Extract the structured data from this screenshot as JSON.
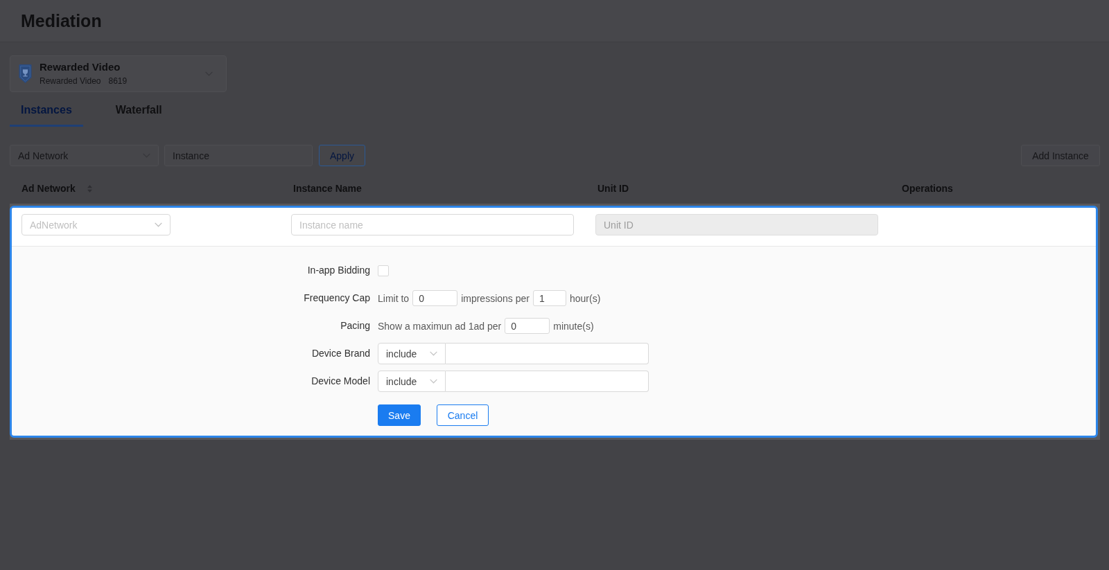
{
  "header": {
    "title": "Mediation"
  },
  "placement": {
    "name": "Rewarded Video",
    "type": "Rewarded Video",
    "code": "8619"
  },
  "tabs": [
    {
      "label": "Instances",
      "selected": true
    },
    {
      "label": "Waterfall",
      "selected": false
    }
  ],
  "filters": {
    "fields": [
      {
        "kind": "select",
        "placeholder": "Ad Network"
      },
      {
        "kind": "input",
        "placeholder": "Instance"
      }
    ],
    "apply_button": "Apply",
    "add_button": "Add Instance"
  },
  "table": {
    "columns": [
      {
        "label": "Ad Network",
        "sortable": true
      },
      {
        "label": "Instance Name",
        "sortable": false
      },
      {
        "label": "Unit ID",
        "sortable": false
      },
      {
        "label": "Operations",
        "sortable": false
      }
    ],
    "edit_row": {
      "cells": [
        {
          "kind": "select",
          "placeholder": "AdNetwork",
          "disabled": false
        },
        {
          "kind": "input",
          "placeholder": "Instance name",
          "disabled": false
        },
        {
          "kind": "input",
          "placeholder": "Unit ID",
          "disabled": true
        }
      ],
      "fields": [
        {
          "kind": "checkbox",
          "label": "In-app Bidding",
          "checked": false
        },
        {
          "kind": "inline",
          "label": "Frequency Cap",
          "parts": [
            {
              "kind": "text",
              "text": "Limit to"
            },
            {
              "kind": "input",
              "value": "0"
            },
            {
              "kind": "text",
              "text": "impressions per"
            },
            {
              "kind": "input",
              "value": "1"
            },
            {
              "kind": "text",
              "text": "hour(s)"
            }
          ]
        },
        {
          "kind": "inline",
          "label": "Pacing",
          "parts": [
            {
              "kind": "text",
              "text": "Show a maximun ad 1ad per"
            },
            {
              "kind": "input",
              "value": "0"
            },
            {
              "kind": "text",
              "text": "minute(s)"
            }
          ]
        },
        {
          "kind": "combo",
          "label": "Device Brand",
          "operator": "include"
        },
        {
          "kind": "combo",
          "label": "Device Model",
          "operator": "include"
        }
      ],
      "actions": [
        {
          "kind": "save",
          "label": "Save"
        },
        {
          "kind": "cancel",
          "label": "Cancel"
        }
      ]
    }
  }
}
